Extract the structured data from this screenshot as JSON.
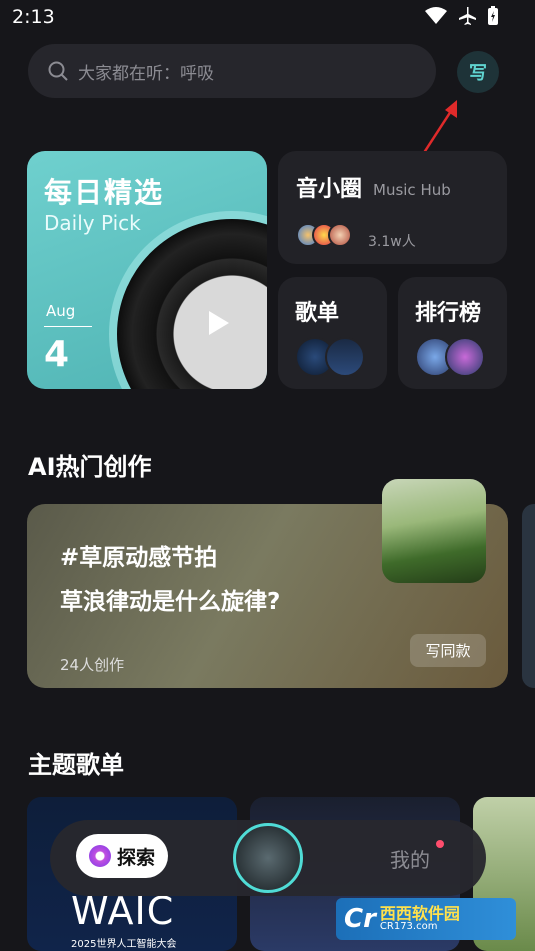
{
  "status": {
    "time": "2:13"
  },
  "search": {
    "placeholder": "大家都在听：呼吸"
  },
  "write_button": {
    "label": "写"
  },
  "daily": {
    "title": "每日精选",
    "subtitle": "Daily Pick",
    "month": "Aug",
    "day": "4"
  },
  "hub": {
    "title": "音小圈",
    "subtitle": "Music Hub",
    "count": "3.1w人"
  },
  "playlist_card": {
    "title": "歌单"
  },
  "chart_card": {
    "title": "排行榜"
  },
  "sections": {
    "ai": "AI热门创作",
    "theme": "主题歌单"
  },
  "ai_card": {
    "tag": "#草原动感节拍",
    "question": "草浪律动是什么旋律?",
    "count": "24人创作",
    "button": "写同款"
  },
  "theme_cards": [
    {
      "caption": "WAIC",
      "subcaption": "2025世界人工智能大会"
    }
  ],
  "bottom_nav": {
    "explore": "探索",
    "me": "我的"
  },
  "watermark": {
    "logo": "Cr",
    "name": "西西软件园",
    "url": "CR173.com"
  },
  "colors": {
    "accent": "#50dcd6",
    "background": "#16161a",
    "card": "#222227"
  }
}
